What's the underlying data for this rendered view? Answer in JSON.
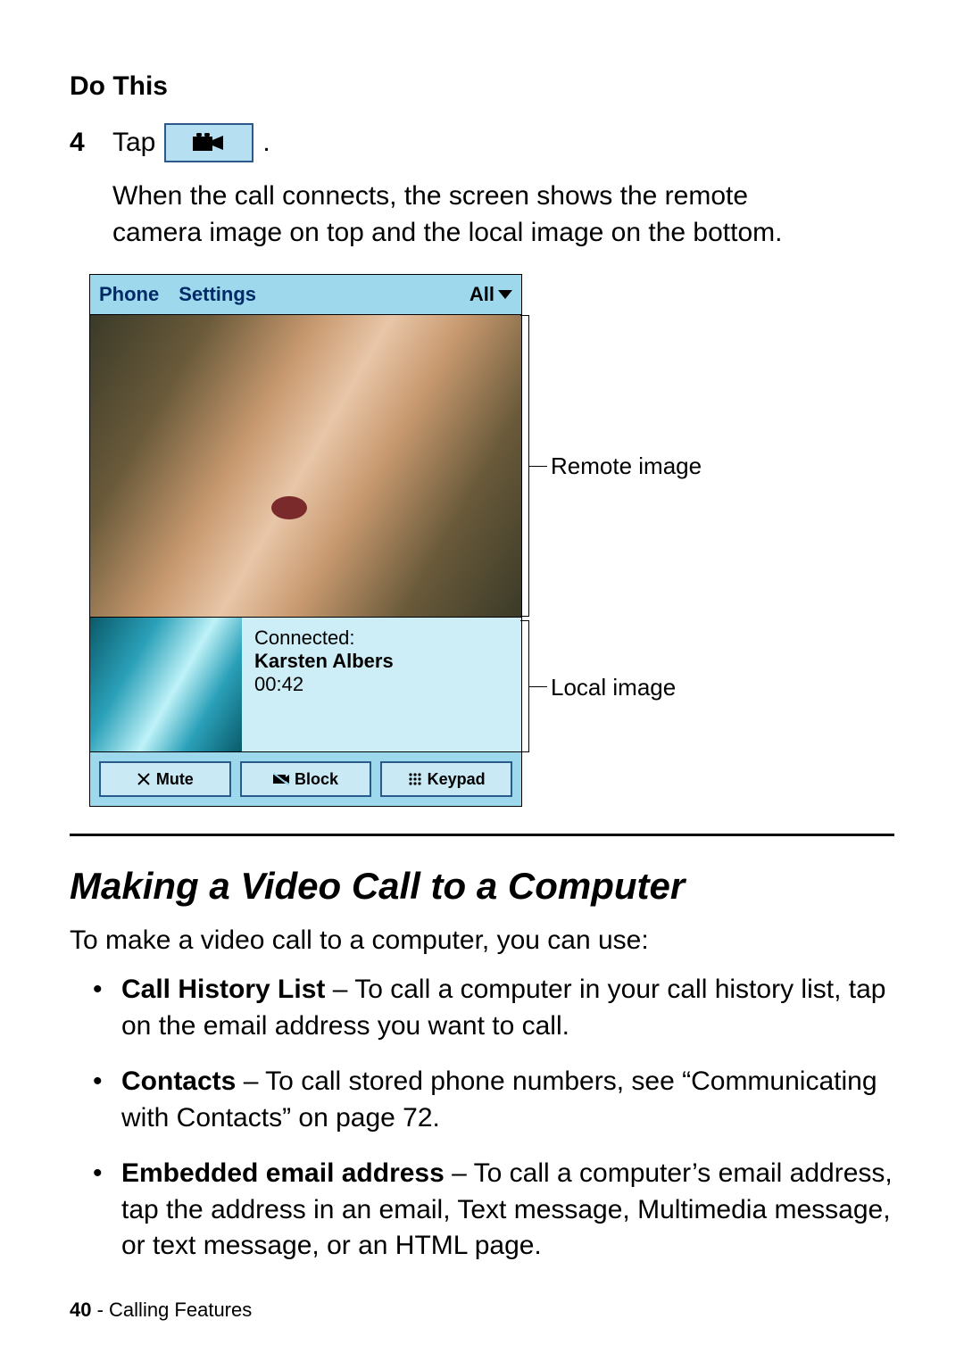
{
  "header": {
    "do_this": "Do This"
  },
  "step": {
    "number": "4",
    "tap": "Tap",
    "body": "When the call connects, the screen shows the remote camera image on top and the local image on the bottom."
  },
  "phone": {
    "menu": {
      "phone": "Phone",
      "settings": "Settings",
      "all": "All"
    },
    "call": {
      "connected": "Connected:",
      "name": "Karsten Albers",
      "time": "00:42"
    },
    "buttons": {
      "mute": "Mute",
      "block": "Block",
      "keypad": "Keypad"
    }
  },
  "callouts": {
    "remote": "Remote image",
    "local": "Local image"
  },
  "section": {
    "heading": "Making a Video Call to a Computer",
    "intro": "To make a video call to a computer, you can use:",
    "items": [
      {
        "label": "Call History List",
        "text": " – To call a computer in your call history list, tap on the email address you want to call."
      },
      {
        "label": "Contacts",
        "text": " – To call stored phone numbers, see “Communicating with Contacts” on page 72."
      },
      {
        "label": "Embedded email address",
        "text": " – To call a computer’s email address, tap the address in an email, Text message, Multimedia message, or text message, or an HTML page."
      }
    ]
  },
  "footer": {
    "page": "40",
    "sep": " - ",
    "chapter": "Calling Features"
  }
}
